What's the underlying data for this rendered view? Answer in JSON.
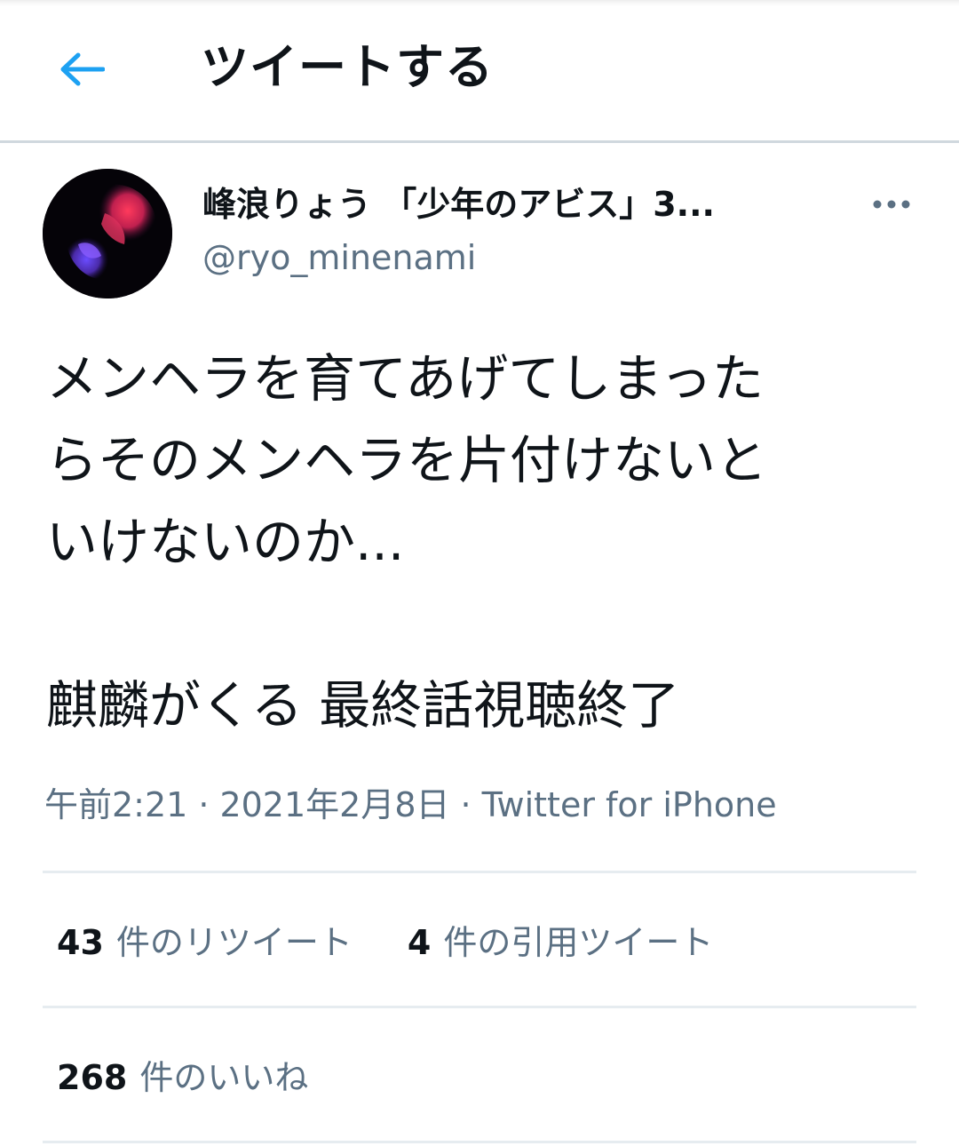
{
  "header": {
    "title": "ツイートする",
    "back_icon": "arrow-left-icon",
    "accent": "#1da1f2"
  },
  "author": {
    "display_name": "峰浪りょう 「少年のアビス」3...",
    "handle": "@ryo_minenami",
    "avatar_icon": "betta-fish-avatar"
  },
  "tweet": {
    "line1": "メンヘラを育てあげてしまった",
    "line2": "らそのメンヘラを片付けないと",
    "line3": "いけないのか...",
    "line4": "麒麟がくる 最終話視聴終了"
  },
  "meta": {
    "time": "午前2:21",
    "sep1": "·",
    "date": "2021年2月8日",
    "sep2": "·",
    "source": "Twitter for iPhone"
  },
  "stats": {
    "retweets_count": "43",
    "retweets_label": "件のリツイート",
    "quotes_count": "4",
    "quotes_label": "件の引用ツイート",
    "likes_count": "268",
    "likes_label": "件のいいね"
  },
  "colors": {
    "text": "#0f1419",
    "secondary": "#5b7083",
    "divider": "#e6ecf0"
  }
}
